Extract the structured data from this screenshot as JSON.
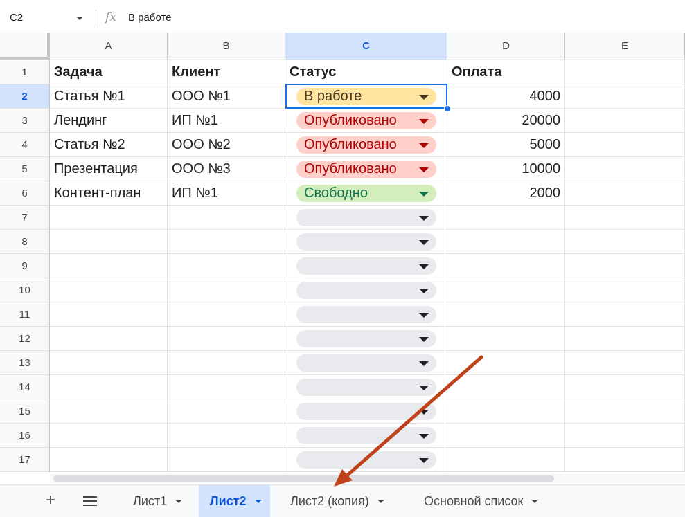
{
  "formula_bar": {
    "cell_ref": "C2",
    "fx_label": "fx",
    "value": "В работе"
  },
  "columns": [
    "A",
    "B",
    "C",
    "D",
    "E"
  ],
  "selected_column": "C",
  "rows": [
    {
      "num": "1",
      "a": "Задача",
      "b": "Клиент",
      "c": {
        "label": "Статус",
        "type": "header"
      },
      "d": "Оплата"
    },
    {
      "num": "2",
      "a": "Статья №1",
      "b": "ООО №1",
      "c": {
        "label": "В работе",
        "type": "working"
      },
      "d": "4000"
    },
    {
      "num": "3",
      "a": "Лендинг",
      "b": "ИП №1",
      "c": {
        "label": "Опубликовано",
        "type": "published"
      },
      "d": "20000"
    },
    {
      "num": "4",
      "a": "Статья №2",
      "b": "ООО №2",
      "c": {
        "label": "Опубликовано",
        "type": "published"
      },
      "d": "5000"
    },
    {
      "num": "5",
      "a": "Презентация",
      "b": "ООО №3",
      "c": {
        "label": "Опубликовано",
        "type": "published"
      },
      "d": "10000"
    },
    {
      "num": "6",
      "a": "Контент-план",
      "b": "ИП №1",
      "c": {
        "label": "Свободно",
        "type": "free"
      },
      "d": "2000"
    },
    {
      "num": "7",
      "a": "",
      "b": "",
      "c": {
        "label": "",
        "type": "empty"
      },
      "d": ""
    },
    {
      "num": "8",
      "a": "",
      "b": "",
      "c": {
        "label": "",
        "type": "empty"
      },
      "d": ""
    },
    {
      "num": "9",
      "a": "",
      "b": "",
      "c": {
        "label": "",
        "type": "empty"
      },
      "d": ""
    },
    {
      "num": "10",
      "a": "",
      "b": "",
      "c": {
        "label": "",
        "type": "empty"
      },
      "d": ""
    },
    {
      "num": "11",
      "a": "",
      "b": "",
      "c": {
        "label": "",
        "type": "empty"
      },
      "d": ""
    },
    {
      "num": "12",
      "a": "",
      "b": "",
      "c": {
        "label": "",
        "type": "empty"
      },
      "d": ""
    },
    {
      "num": "13",
      "a": "",
      "b": "",
      "c": {
        "label": "",
        "type": "empty"
      },
      "d": ""
    },
    {
      "num": "14",
      "a": "",
      "b": "",
      "c": {
        "label": "",
        "type": "empty"
      },
      "d": ""
    },
    {
      "num": "15",
      "a": "",
      "b": "",
      "c": {
        "label": "",
        "type": "empty"
      },
      "d": ""
    },
    {
      "num": "16",
      "a": "",
      "b": "",
      "c": {
        "label": "",
        "type": "empty"
      },
      "d": ""
    },
    {
      "num": "17",
      "a": "",
      "b": "",
      "c": {
        "label": "",
        "type": "empty"
      },
      "d": ""
    }
  ],
  "status_colors": {
    "working": {
      "bg": "#ffe5a0",
      "fg": "#473821"
    },
    "published": {
      "bg": "#ffcfc9",
      "fg": "#b10202"
    },
    "free": {
      "bg": "#d4edbc",
      "fg": "#11734b"
    },
    "empty": {
      "bg": "#e8eaed",
      "fg": "#202124"
    }
  },
  "selection": {
    "cell": "C2"
  },
  "sheet_tabs": [
    {
      "label": "Лист1",
      "active": false
    },
    {
      "label": "Лист2",
      "active": true
    },
    {
      "label": "Лист2 (копия)",
      "active": false
    },
    {
      "label": "Основной список",
      "active": false
    }
  ],
  "sheet_bar": {
    "add_icon": "plus-icon",
    "menu_icon": "all-sheets-icon"
  },
  "annotation": {
    "arrow_color": "#c0421b"
  }
}
